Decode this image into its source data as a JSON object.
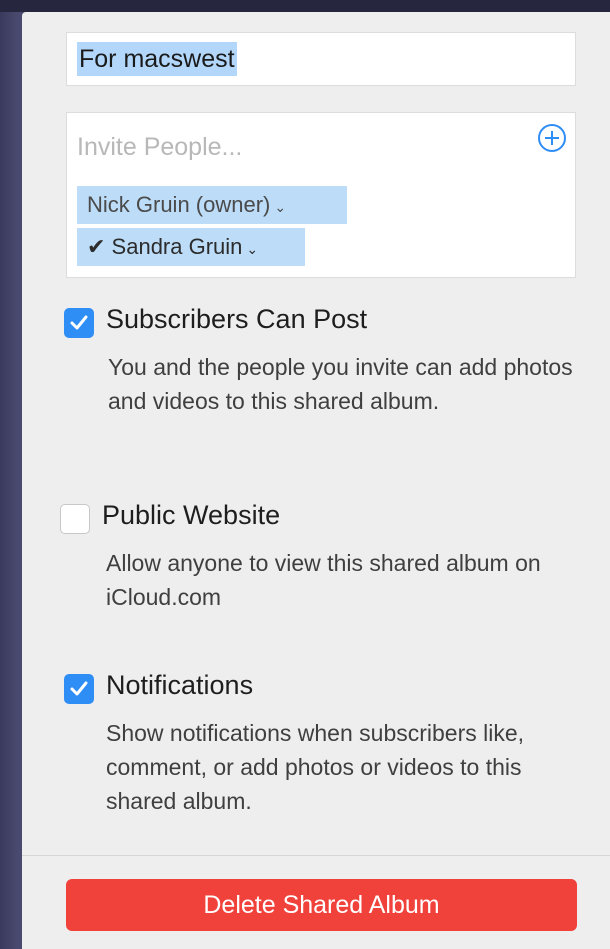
{
  "album": {
    "name_value": "For macswest"
  },
  "invite": {
    "placeholder": "Invite People...",
    "people": [
      {
        "label": "Nick Gruin (owner)",
        "chevron": "⌄"
      },
      {
        "label": "✔ Sandra Gruin",
        "chevron": "⌄"
      }
    ]
  },
  "options": {
    "subscribers_can_post": {
      "label": "Subscribers Can Post",
      "checked": true,
      "description": "You and the people you invite can add photos and videos to this shared album."
    },
    "public_website": {
      "label": "Public Website",
      "checked": false,
      "description": "Allow anyone to view this shared album on iCloud.com"
    },
    "notifications": {
      "label": "Notifications",
      "checked": true,
      "description": "Show notifications when subscribers like, comment, or add photos or videos to this shared album."
    }
  },
  "actions": {
    "delete_label": "Delete Shared Album"
  },
  "colors": {
    "accent": "#2f8df6",
    "danger": "#f0413a",
    "selection": "#b3d7fb"
  },
  "icons": {
    "add": "plus-circle-icon",
    "check": "checkmark-icon",
    "chevron": "chevron-down-icon"
  }
}
